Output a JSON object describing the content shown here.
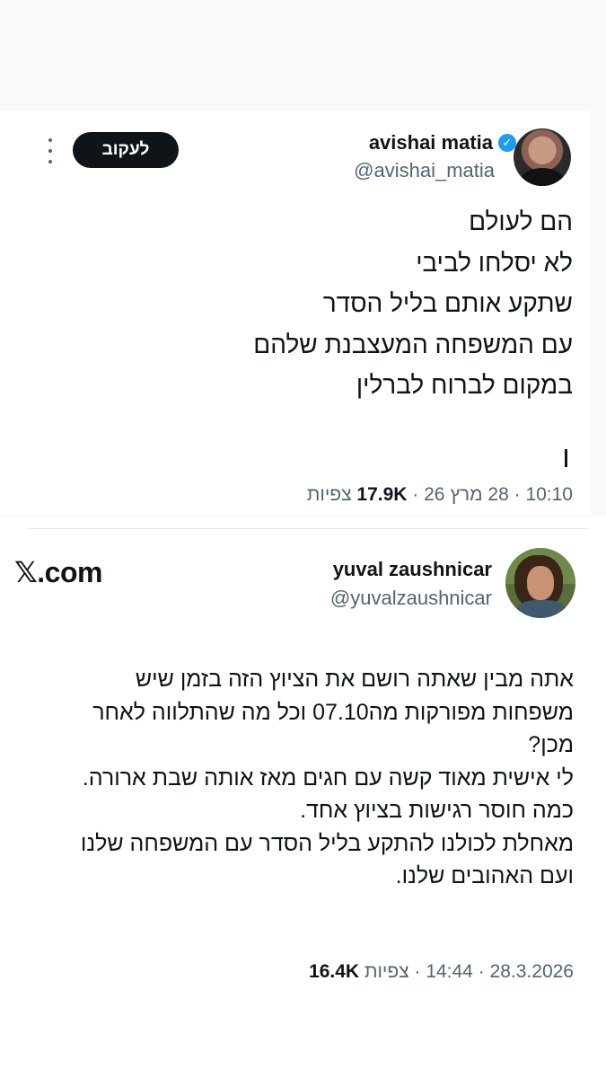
{
  "tweet1": {
    "display_name": "avishai matia",
    "handle": "@avishai_matia",
    "follow_label": "לעקוב",
    "lines": [
      "הם לעולם",
      "לא יסלחו לביבי",
      "שתקע אותם בליל הסדר",
      "עם המשפחה המעצבנת שלהם",
      "במקום לברוח לברלין"
    ],
    "time": "10:10",
    "date": "28 מרץ 26",
    "views_count": "17.9K",
    "views_label": "צפיות",
    "separator": "·",
    "icons": [
      "verified-badge-icon",
      "more-options-icon"
    ],
    "accent_color": "#1d9bf0"
  },
  "tweet2": {
    "display_name": "yuval zaushnicar",
    "handle": "@yuvalzaushnicar",
    "site_label": "𝕏.com",
    "lines": [
      "אתה מבין שאתה רושם את הציוץ הזה בזמן שיש",
      "משפחות מפורקות מה07.10 וכל מה שהתלווה לאחר",
      "מכן?",
      "לי אישית מאוד קשה עם חגים מאז אותה שבת ארורה.",
      "כמה חוסר רגישות בציוץ אחד.",
      "מאחלת לכולנו להתקע בליל הסדר עם המשפחה שלנו",
      "ועם האהובים שלנו."
    ],
    "date": "28.3.2026",
    "time": "14:44",
    "views_label": "צפיות",
    "views_count": "16.4K",
    "separator": "·"
  }
}
